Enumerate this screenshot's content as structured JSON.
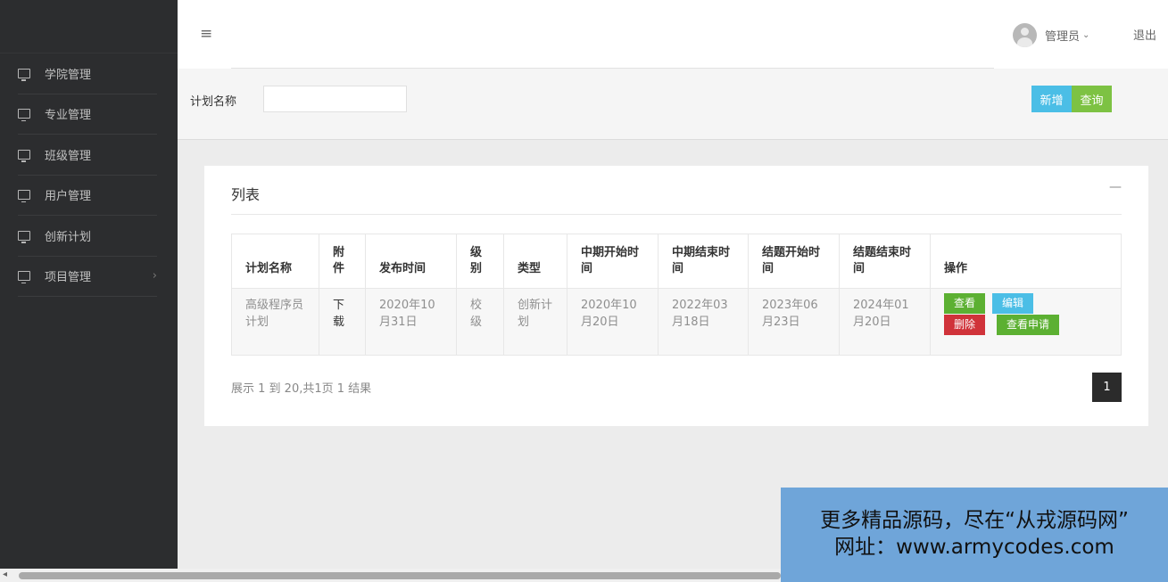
{
  "sidebar": {
    "items": [
      {
        "label": "学院管理",
        "icon": "monitor-icon"
      },
      {
        "label": "专业管理",
        "icon": "monitor-icon"
      },
      {
        "label": "班级管理",
        "icon": "monitor-icon"
      },
      {
        "label": "用户管理",
        "icon": "monitor-icon"
      },
      {
        "label": "创新计划",
        "icon": "monitor-icon"
      },
      {
        "label": "项目管理",
        "icon": "monitor-icon",
        "chevron": "›"
      }
    ]
  },
  "header": {
    "menu_icon": "≡",
    "user_name": "管理员",
    "user_caret": "⌄",
    "logout": "退出"
  },
  "search": {
    "label": "计划名称",
    "value": "",
    "add_button": "新增",
    "search_button": "查询"
  },
  "panel": {
    "title": "列表",
    "collapse_icon": "—",
    "columns": [
      "计划名称",
      "附件",
      "发布时间",
      "级别",
      "类型",
      "中期开始时间",
      "中期结束时间",
      "结题开始时间",
      "结题结束时间",
      "操作"
    ],
    "rows": [
      {
        "name": "高级程序员计划",
        "attachment": "下载",
        "publish_time": "2020年10月31日",
        "level": "校级",
        "type": "创新计划",
        "mid_start": "2020年10月20日",
        "mid_end": "2022年03月18日",
        "final_start": "2023年06月23日",
        "final_end": "2024年01月20日",
        "actions": {
          "view": "查看",
          "edit": "编辑",
          "delete": "删除",
          "view_apply": "查看申请"
        }
      }
    ],
    "summary": "展示 1 到 20,共1页 1 结果",
    "current_page": "1"
  },
  "watermark": {
    "line1": "更多精品源码，尽在“从戎源码网”",
    "line2": "网址：www.armycodes.com"
  },
  "colors": {
    "sidebar_bg": "#2c2d2f",
    "btn_blue": "#4bbee6",
    "btn_green": "#7dc243",
    "btn_red": "#d0333a",
    "watermark_bg": "#6fa5d9"
  }
}
